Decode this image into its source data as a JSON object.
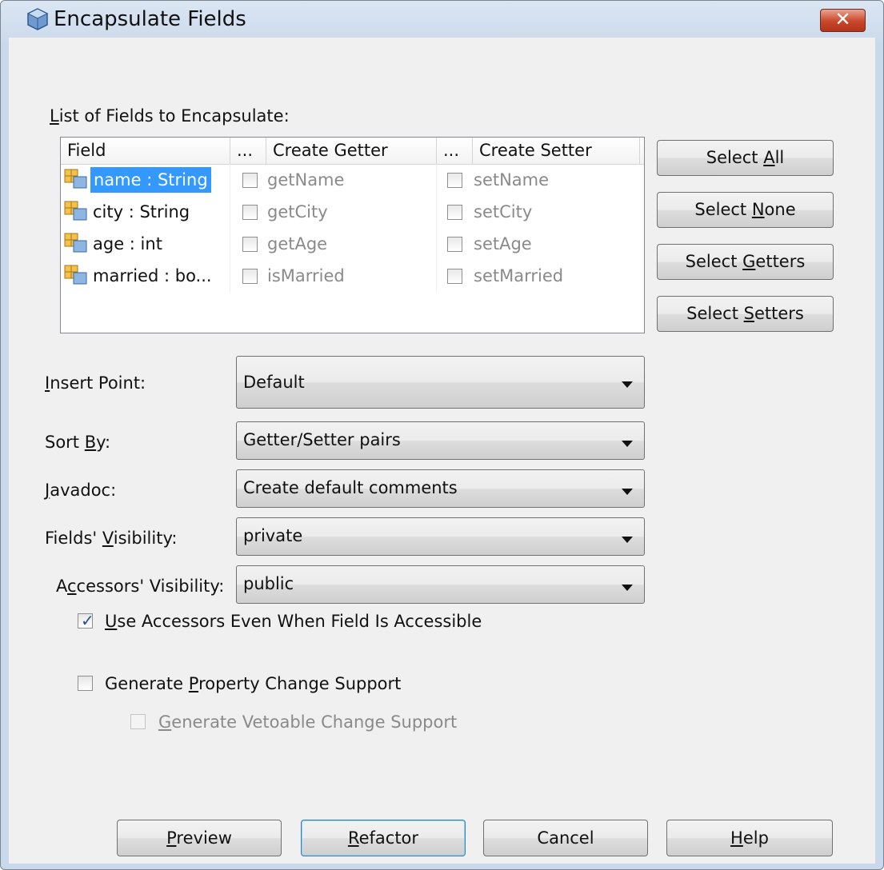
{
  "window": {
    "title": "Encapsulate Fields",
    "close_label": "✕"
  },
  "list_label": {
    "mnemonic": "L",
    "rest": "ist of Fields to Encapsulate:"
  },
  "table": {
    "headers": {
      "field": "Field",
      "getter_dots": "...",
      "getter": "Create Getter",
      "setter_dots": "...",
      "setter": "Create Setter"
    },
    "rows": [
      {
        "field": "name : String",
        "getter": "getName",
        "setter": "setName",
        "selected": true
      },
      {
        "field": "city : String",
        "getter": "getCity",
        "setter": "setCity",
        "selected": false
      },
      {
        "field": "age : int",
        "getter": "getAge",
        "setter": "setAge",
        "selected": false
      },
      {
        "field": "married : bo...",
        "getter": "isMarried",
        "setter": "setMarried",
        "selected": false
      }
    ]
  },
  "side_buttons": {
    "select_all": {
      "pre": "Select ",
      "mn": "A",
      "post": "ll"
    },
    "select_none": {
      "pre": "Select ",
      "mn": "N",
      "post": "one"
    },
    "select_getters": {
      "pre": "Select ",
      "mn": "G",
      "post": "etters"
    },
    "select_setters": {
      "pre": "Select ",
      "mn": "S",
      "post": "etters"
    }
  },
  "options": {
    "insert_point": {
      "pre": "",
      "mn": "I",
      "post": "nsert Point:",
      "value": "Default"
    },
    "sort_by": {
      "pre": "Sort ",
      "mn": "B",
      "post": "y:",
      "value": "Getter/Setter pairs"
    },
    "javadoc": {
      "pre": "",
      "mn": "J",
      "post": "avadoc:",
      "value": "Create default comments"
    },
    "fields_visibility": {
      "pre": "Fields' ",
      "mn": "V",
      "post": "isibility:",
      "value": "private"
    },
    "accessors_visibility": {
      "pre": "A",
      "mn": "c",
      "post": "cessors' Visibility:",
      "value": "public"
    }
  },
  "checkboxes": {
    "use_accessors": {
      "mn": "U",
      "post": "se Accessors Even When Field Is Accessible",
      "checked": true
    },
    "property_change": {
      "pre": "Generate ",
      "mn": "P",
      "post": "roperty Change Support",
      "checked": false
    },
    "vetoable_change": {
      "mn": "G",
      "post": "enerate Vetoable Change Support",
      "checked": false,
      "enabled": false
    }
  },
  "footer_buttons": {
    "preview": {
      "mn": "P",
      "post": "review"
    },
    "refactor": {
      "mn": "R",
      "post": "efactor"
    },
    "cancel": {
      "label": "Cancel"
    },
    "help": {
      "mn": "H",
      "post": "elp"
    }
  },
  "colors": {
    "selection": "#3399ff",
    "title_bg": "#c9d8ea",
    "client_bg": "#f0f0f0",
    "close": "#c9462a"
  },
  "icons": {
    "app": "netbeans-cube-icon",
    "field": "field-variable-icon",
    "checkmark": "checkmark-icon"
  }
}
